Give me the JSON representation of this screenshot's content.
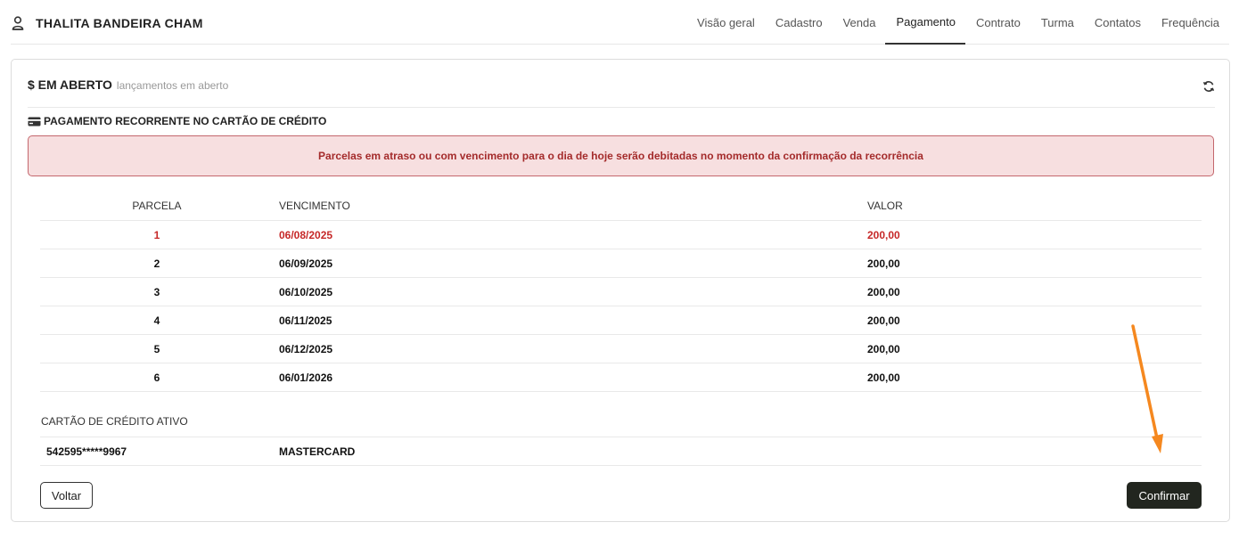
{
  "header": {
    "student_name": "THALITA BANDEIRA CHAM",
    "tabs": [
      {
        "label": "Visão geral",
        "active": false
      },
      {
        "label": "Cadastro",
        "active": false
      },
      {
        "label": "Venda",
        "active": false
      },
      {
        "label": "Pagamento",
        "active": true
      },
      {
        "label": "Contrato",
        "active": false
      },
      {
        "label": "Turma",
        "active": false
      },
      {
        "label": "Contatos",
        "active": false
      },
      {
        "label": "Frequência",
        "active": false
      }
    ]
  },
  "card": {
    "title": "$ EM ABERTO",
    "subtitle": "lançamentos em aberto",
    "section_title": "PAGAMENTO RECORRENTE NO CARTÃO DE CRÉDITO",
    "alert": "Parcelas em atraso ou com vencimento para o dia de hoje serão debitadas no momento da confirmação da recorrência",
    "table": {
      "columns": [
        "PARCELA",
        "VENCIMENTO",
        "VALOR"
      ],
      "rows": [
        {
          "parcela": "1",
          "vencimento": "06/08/2025",
          "valor": "200,00",
          "overdue": true
        },
        {
          "parcela": "2",
          "vencimento": "06/09/2025",
          "valor": "200,00",
          "overdue": false
        },
        {
          "parcela": "3",
          "vencimento": "06/10/2025",
          "valor": "200,00",
          "overdue": false
        },
        {
          "parcela": "4",
          "vencimento": "06/11/2025",
          "valor": "200,00",
          "overdue": false
        },
        {
          "parcela": "5",
          "vencimento": "06/12/2025",
          "valor": "200,00",
          "overdue": false
        },
        {
          "parcela": "6",
          "vencimento": "06/01/2026",
          "valor": "200,00",
          "overdue": false
        }
      ]
    },
    "credit_card": {
      "title": "CARTÃO DE CRÉDITO ATIVO",
      "number": "542595*****9967",
      "brand": "MASTERCARD"
    },
    "buttons": {
      "back": "Voltar",
      "confirm": "Confirmar"
    }
  },
  "colors": {
    "overdue_text": "#c62828",
    "alert_bg": "#f7dfe0",
    "alert_border": "#c4676d",
    "confirm_bg": "#22261f",
    "annotation_arrow": "#f5881f"
  },
  "icons": {
    "user": "user-icon",
    "refresh": "refresh-icon",
    "credit_card": "credit-card-icon"
  }
}
